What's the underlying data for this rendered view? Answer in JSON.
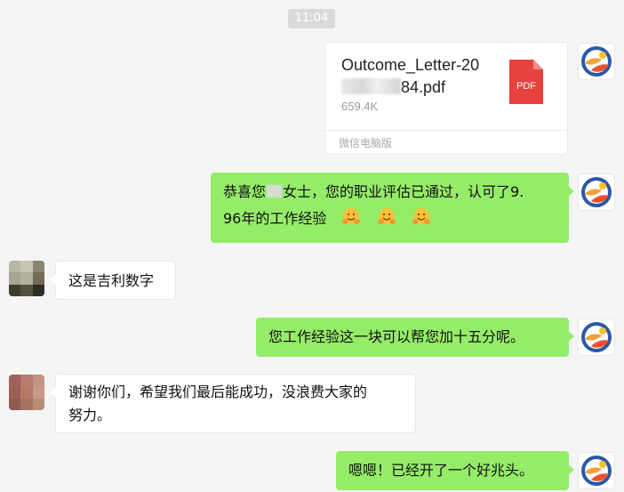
{
  "time": "11:04",
  "file_message": {
    "name_line1": "Outcome_Letter-20",
    "name_line2_suffix": "84.pdf",
    "size": "659.4K",
    "footer": "微信电脑版",
    "icon_label": "PDF",
    "icon_color": "#e64340"
  },
  "messages": [
    {
      "side": "right",
      "text_a": "恭喜您",
      "text_b": "女士，您的职业评估已通过，认可了9.",
      "text_c": "96年的工作经验",
      "emoji": "hugging-face-icon"
    },
    {
      "side": "left",
      "text": "这是吉利数字"
    },
    {
      "side": "right",
      "text": "您工作经验这一块可以帮您加十五分呢。"
    },
    {
      "side": "left",
      "text_line1": "谢谢你们，希望我们最后能成功，没浪费大家的",
      "text_line2": "努力。"
    },
    {
      "side": "right",
      "text": "嗯嗯！已经开了一个好兆头。"
    }
  ],
  "colors": {
    "background": "#f5f5f5",
    "sent_bubble": "#95ec69",
    "received_bubble": "#ffffff",
    "timestamp_bg": "#dadada"
  }
}
